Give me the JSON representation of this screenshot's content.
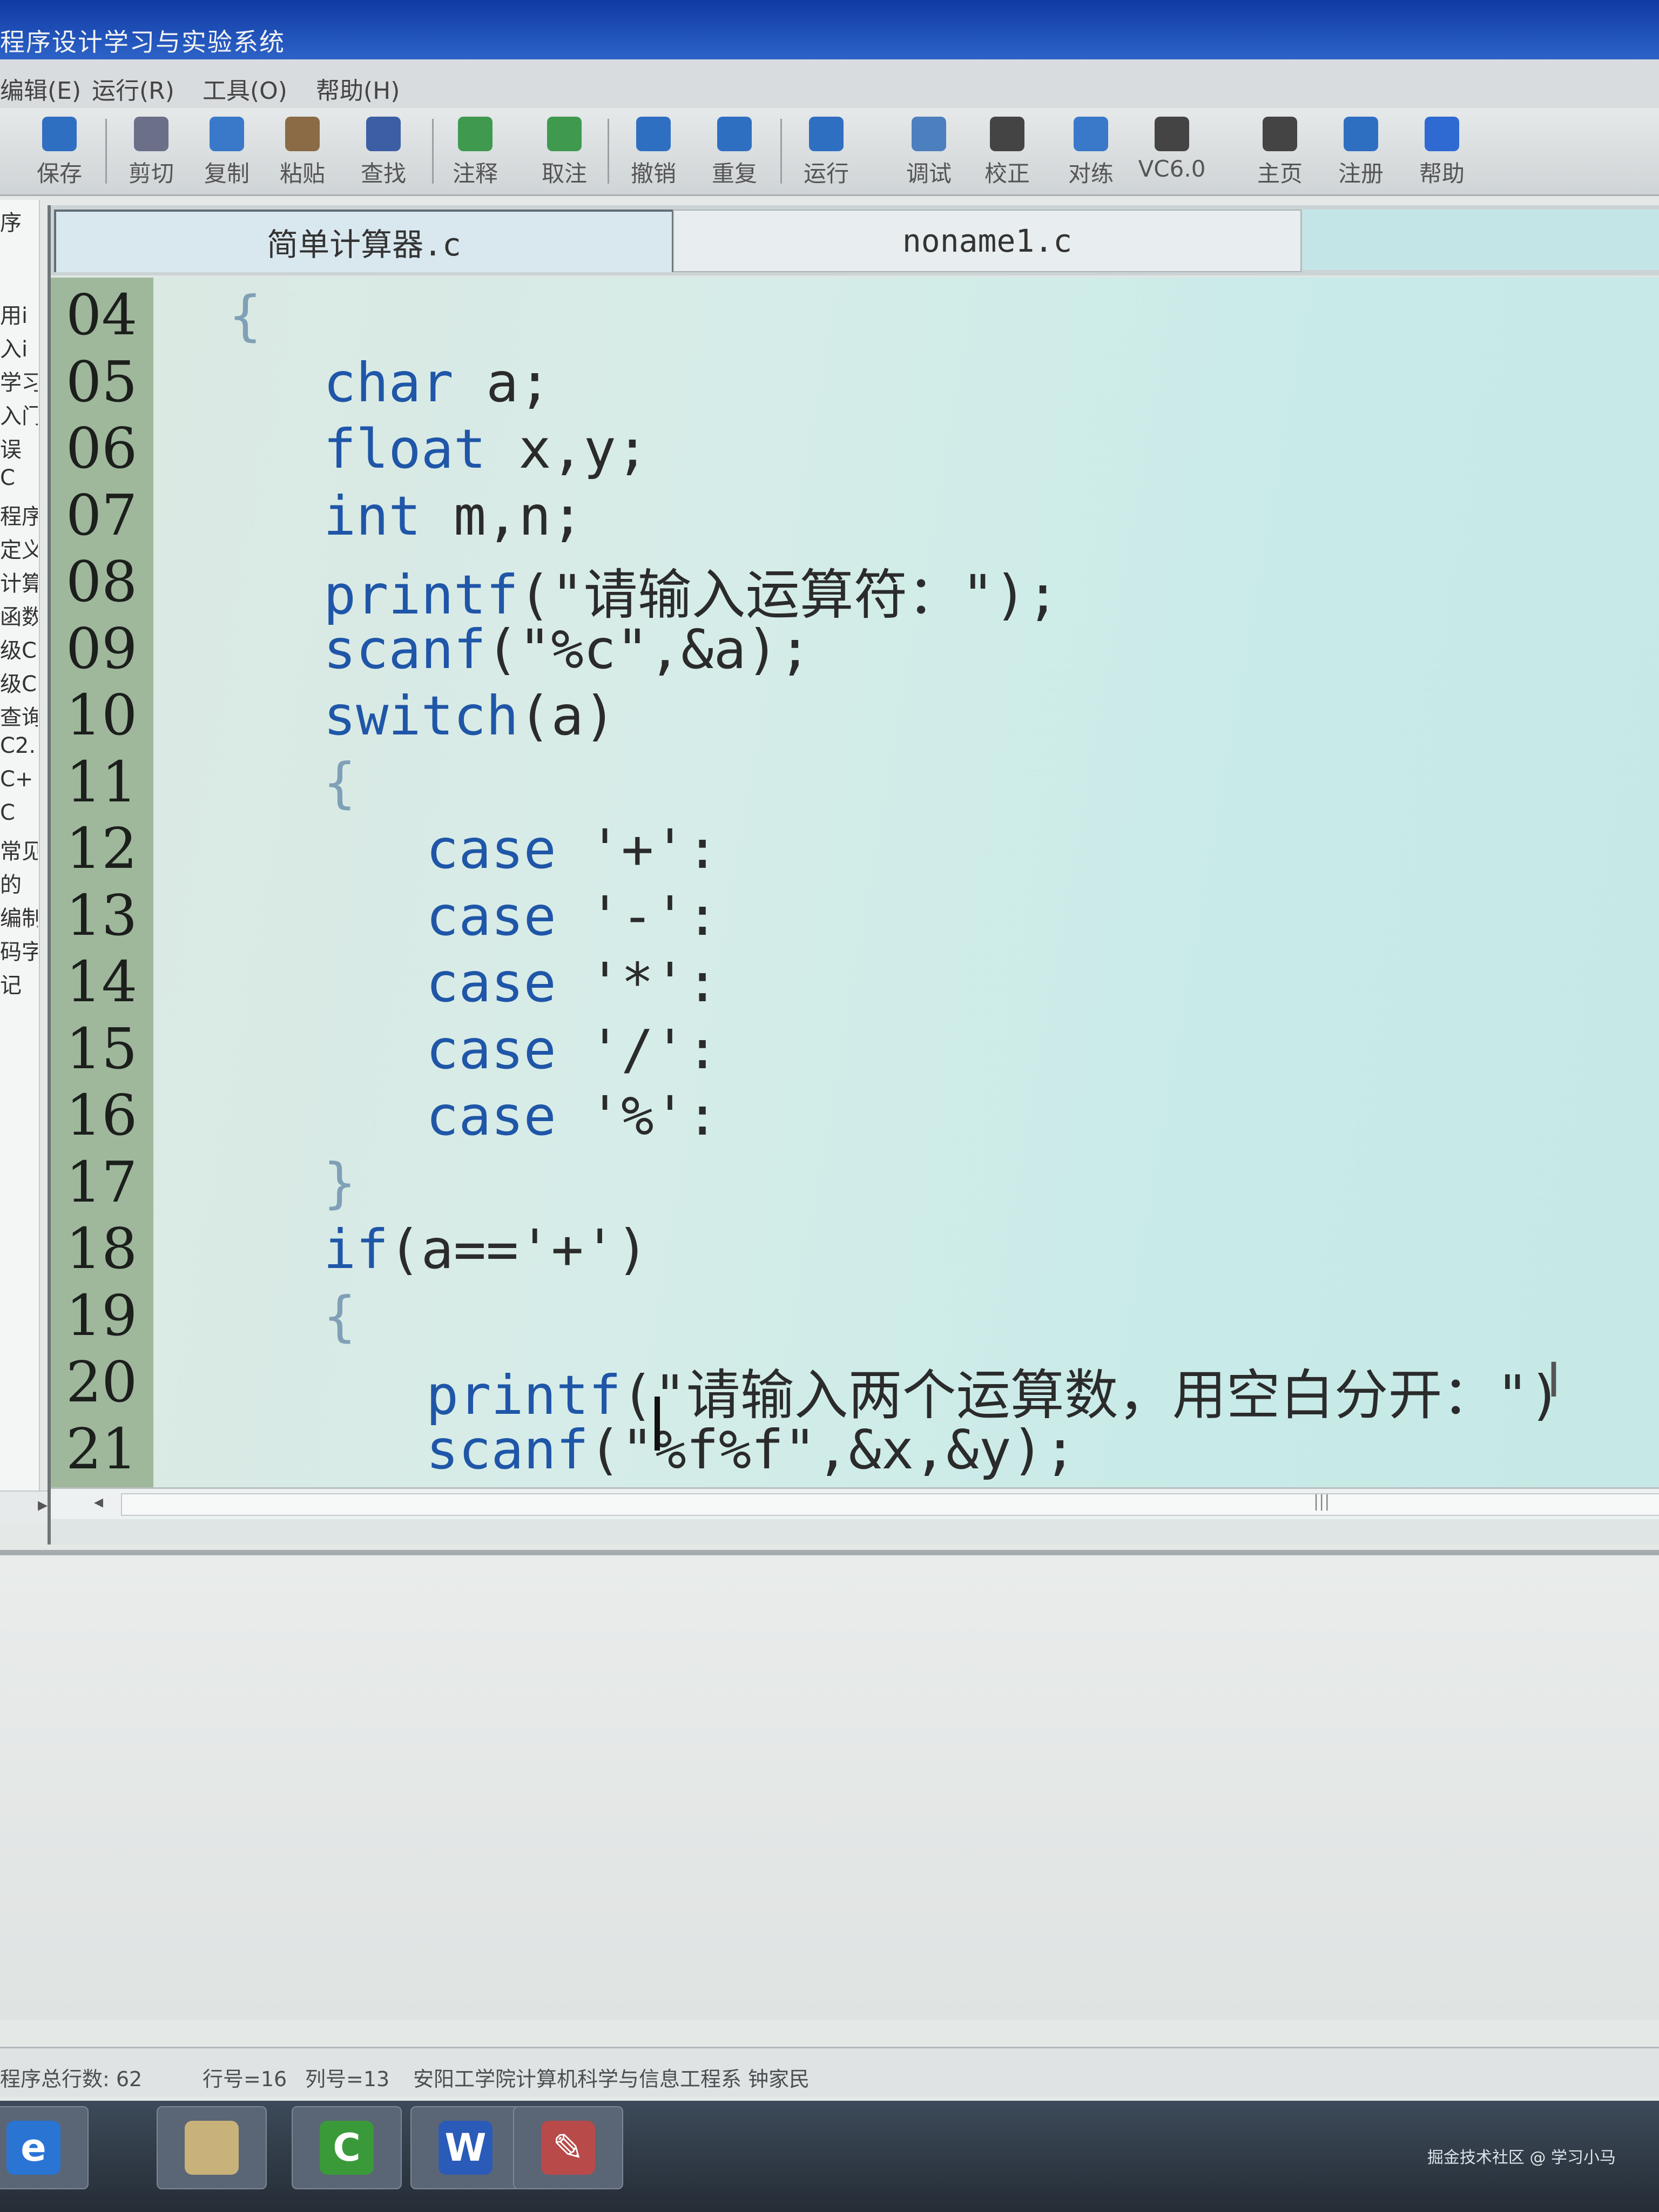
{
  "window": {
    "title": "程序设计学习与实验系统"
  },
  "menu": [
    "编辑(E)",
    "运行(R)",
    "工具(O)",
    "帮助(H)"
  ],
  "toolbar": [
    {
      "label": "保存",
      "icon": "save-icon",
      "color": "#2f6fc2"
    },
    {
      "label": "剪切",
      "icon": "cut-icon",
      "color": "#6c6f88"
    },
    {
      "label": "复制",
      "icon": "copy-icon",
      "color": "#3a79c9"
    },
    {
      "label": "粘贴",
      "icon": "paste-icon",
      "color": "#8a6b46"
    },
    {
      "label": "查找",
      "icon": "find-icon",
      "color": "#3c5ea3"
    },
    {
      "label": "注释",
      "icon": "comment-icon",
      "color": "#3f9a4f"
    },
    {
      "label": "取注",
      "icon": "uncomment-icon",
      "color": "#3f9a4f"
    },
    {
      "label": "撤销",
      "icon": "undo-icon",
      "color": "#2f6fc2"
    },
    {
      "label": "重复",
      "icon": "redo-icon",
      "color": "#2f6fc2"
    },
    {
      "label": "运行",
      "icon": "run-icon",
      "color": "#2f6fc2"
    },
    {
      "label": "调试",
      "icon": "debug-icon",
      "color": "#4c7fbe"
    },
    {
      "label": "校正",
      "icon": "check-icon",
      "color": "#444444"
    },
    {
      "label": "对练",
      "icon": "practice-icon",
      "color": "#3a79c9"
    },
    {
      "label": "VC6.0",
      "icon": "vc6-icon",
      "color": "#444444"
    },
    {
      "label": "主页",
      "icon": "home-icon",
      "color": "#444444"
    },
    {
      "label": "注册",
      "icon": "register-icon",
      "color": "#2f6fc2"
    },
    {
      "label": "帮助",
      "icon": "help-icon",
      "color": "#2e6ad1"
    }
  ],
  "left_panel": [
    "序",
    "用i",
    "入i",
    "学习",
    "入门",
    "误",
    "C",
    "程序",
    "定义",
    "计算",
    "函数",
    "级C",
    "级C",
    "查询",
    "C2.",
    "C+",
    "C",
    "常见",
    "的",
    "编制",
    "码字",
    "记"
  ],
  "tabs": {
    "active": "简单计算器.c",
    "inactive": "noname1.c"
  },
  "code_lines": [
    {
      "num": "04",
      "text": "{",
      "indent": 0,
      "color": "#7fa0b6"
    },
    {
      "num": "05",
      "text": "char a;",
      "indent": 1,
      "color": "#2b2b2b"
    },
    {
      "num": "06",
      "text": "float x,y;",
      "indent": 1,
      "color": "#2b2b2b"
    },
    {
      "num": "07",
      "text": "int m,n;",
      "indent": 1,
      "color": "#2b2b2b"
    },
    {
      "num": "08",
      "text": "printf(\"请输入运算符：\");",
      "indent": 1,
      "color": "#2b2b2b"
    },
    {
      "num": "09",
      "text": "scanf(\"%c\",&a);",
      "indent": 1,
      "color": "#2b2b2b"
    },
    {
      "num": "10",
      "text": "switch(a)",
      "indent": 1,
      "color": "#2b2b2b"
    },
    {
      "num": "11",
      "text": "{",
      "indent": 1,
      "color": "#7fa0b6"
    },
    {
      "num": "12",
      "text": "case '+':",
      "indent": 2,
      "color": "#2b2b2b"
    },
    {
      "num": "13",
      "text": "case '-':",
      "indent": 2,
      "color": "#2b2b2b"
    },
    {
      "num": "14",
      "text": "case '*':",
      "indent": 2,
      "color": "#2b2b2b"
    },
    {
      "num": "15",
      "text": "case '/':",
      "indent": 2,
      "color": "#2b2b2b"
    },
    {
      "num": "16",
      "text": "case '%':",
      "indent": 2,
      "color": "#2b2b2b"
    },
    {
      "num": "17",
      "text": "}",
      "indent": 1,
      "color": "#7fa0b6"
    },
    {
      "num": "18",
      "text": "if(a=='+')",
      "indent": 1,
      "color": "#2b2b2b"
    },
    {
      "num": "19",
      "text": "{",
      "indent": 1,
      "color": "#7fa0b6"
    },
    {
      "num": "20",
      "text": "printf(\"请输入两个运算数，用空白分开：\")",
      "indent": 2,
      "color": "#2b2b2b"
    },
    {
      "num": "21",
      "text": "scanf(\"%f%f\",&x,&y);",
      "indent": 2,
      "color": "#2b2b2b"
    }
  ],
  "keyword_color": "#1f56a8",
  "status": {
    "total_lines": "程序总行数: 62",
    "row": "行号=16",
    "col": "列号=13",
    "credit": "安阳工学院计算机科学与信息工程系  钟家民"
  },
  "taskbar": [
    {
      "name": "ie",
      "glyph": "e",
      "color": "#2a74d4"
    },
    {
      "name": "folder",
      "glyph": "",
      "color": "#c9b27a"
    },
    {
      "name": "app",
      "glyph": "C",
      "color": "#3a9a3a"
    },
    {
      "name": "word",
      "glyph": "W",
      "color": "#2b5bb8"
    },
    {
      "name": "tool",
      "glyph": "✎",
      "color": "#b84a4a"
    }
  ],
  "watermark": "掘金技术社区 @ 学习小马"
}
